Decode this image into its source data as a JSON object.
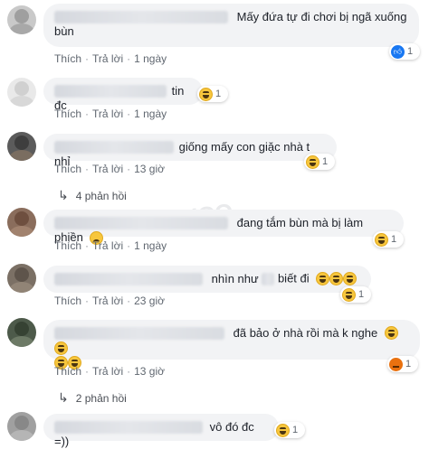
{
  "actions": {
    "like": "Thích",
    "reply": "Trả lời"
  },
  "comments": [
    {
      "text_line1": "Mấy đứa tự đi chơi bị ngã xuống",
      "text_line2": "bùn",
      "time": "1 ngày",
      "reaction": "like",
      "reaction_count": "1"
    },
    {
      "text": "tin đc",
      "time": "1 ngày",
      "reaction": "haha",
      "reaction_count": "1"
    },
    {
      "text": "giống mấy con giặc nhà t nhỉ",
      "time": "13 giờ",
      "reaction": "haha",
      "reaction_count": "1",
      "replies": "4 phản hồi"
    },
    {
      "text": "đang tắm bùn mà bị làm phiền",
      "time": "1 ngày",
      "reaction": "haha",
      "reaction_count": "1",
      "emoji": "sad"
    },
    {
      "text": "nhìn như",
      "text2": "biết đi",
      "time": "23 giờ",
      "reaction": "haha",
      "reaction_count": "1",
      "emoji": "haha x3"
    },
    {
      "text": "đã bảo ở nhà rồi mà k nghe",
      "time": "13 giờ",
      "reaction": "angry",
      "reaction_count": "1",
      "emoji": "haha x4",
      "replies": "2 phản hồi"
    },
    {
      "text": "vô đó đc =))",
      "reaction": "haha",
      "reaction_count": "1"
    }
  ],
  "colors": {
    "bubble": "#f2f3f5",
    "link": "#606770",
    "haha": "#f7c63d",
    "like": "#1877f2"
  }
}
